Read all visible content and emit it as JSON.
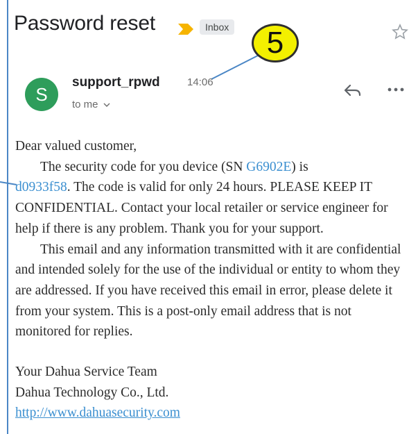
{
  "email": {
    "subject": "Password reset",
    "label": "Inbox",
    "sender": "support_rpwd",
    "time": "14:06",
    "recipients": "to me",
    "avatar_letter": "S"
  },
  "callout": {
    "number": "5"
  },
  "body": {
    "greeting": "Dear valued customer,",
    "p1_before_sn": "The security code for you device (SN ",
    "sn": "G6902E",
    "p1_after_sn": ") is",
    "code": "d0933f58",
    "p1_rest": ". The code is valid for only 24 hours. PLEASE KEEP IT CONFIDENTIAL. Contact your local retailer or service engineer for help if there is any problem. Thank you for your support.",
    "p2": "This email and any information transmitted with it are confidential and intended solely for the use of the individual or entity to whom they are addressed. If you have received this email in error, please delete it from your system. This is a post-only email address that is not monitored for replies.",
    "signature": [
      "Your Dahua Service Team",
      "Dahua Technology Co., Ltd."
    ],
    "link": "http://www.dahuasecurity.com"
  },
  "colors": {
    "avatar": "#2e9d5b",
    "importance_marker": "#f6b400",
    "link": "#3b8fd0",
    "callout_fill": "#f3f000",
    "callout_line": "#4a86c5"
  },
  "icons": [
    "importance-marker-icon",
    "star-icon",
    "reply-icon",
    "more-options-icon",
    "chevron-down-icon"
  ]
}
